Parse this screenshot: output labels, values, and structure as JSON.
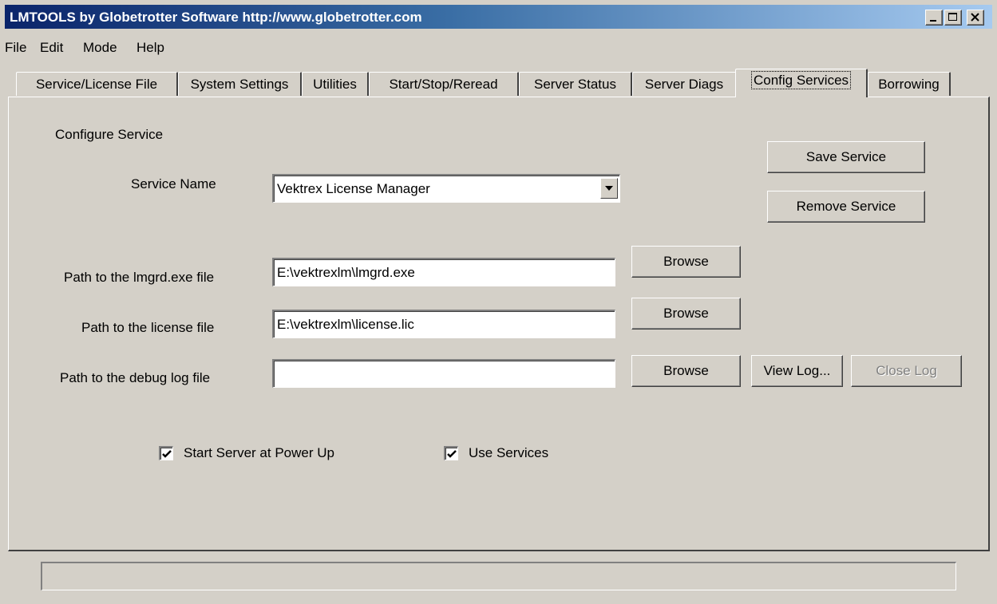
{
  "window": {
    "title": "LMTOOLS by Globetrotter Software http://www.globetrotter.com",
    "title_gradient": [
      "#0a246a",
      "#a6caf0"
    ],
    "face_color": "#d4d0c8"
  },
  "menubar": {
    "items": [
      "File",
      "Edit",
      "Mode",
      "Help"
    ]
  },
  "tabs": [
    {
      "label": "Service/License File",
      "active": false
    },
    {
      "label": "System Settings",
      "active": false
    },
    {
      "label": "Utilities",
      "active": false
    },
    {
      "label": "Start/Stop/Reread",
      "active": false
    },
    {
      "label": "Server Status",
      "active": false
    },
    {
      "label": "Server Diags",
      "active": false
    },
    {
      "label": "Config Services",
      "active": true
    },
    {
      "label": "Borrowing",
      "active": false
    }
  ],
  "config": {
    "section_label": "Configure Service",
    "service_name_label": "Service Name",
    "service_name_value": "Vektrex License Manager",
    "save_service": "Save Service",
    "remove_service": "Remove Service",
    "lmgrd_label": "Path to the lmgrd.exe file",
    "lmgrd_value": "E:\\vektrexlm\\lmgrd.exe",
    "license_label": "Path to the license file",
    "license_value": "E:\\vektrexlm\\license.lic",
    "debug_label": "Path to the debug log file",
    "debug_value": "",
    "browse": "Browse",
    "view_log": "View Log...",
    "close_log": "Close Log",
    "close_log_enabled": false,
    "start_at_power_up_label": "Start Server at Power Up",
    "start_at_power_up_checked": true,
    "use_services_label": "Use Services",
    "use_services_checked": true
  },
  "statusbar": {
    "text": ""
  }
}
